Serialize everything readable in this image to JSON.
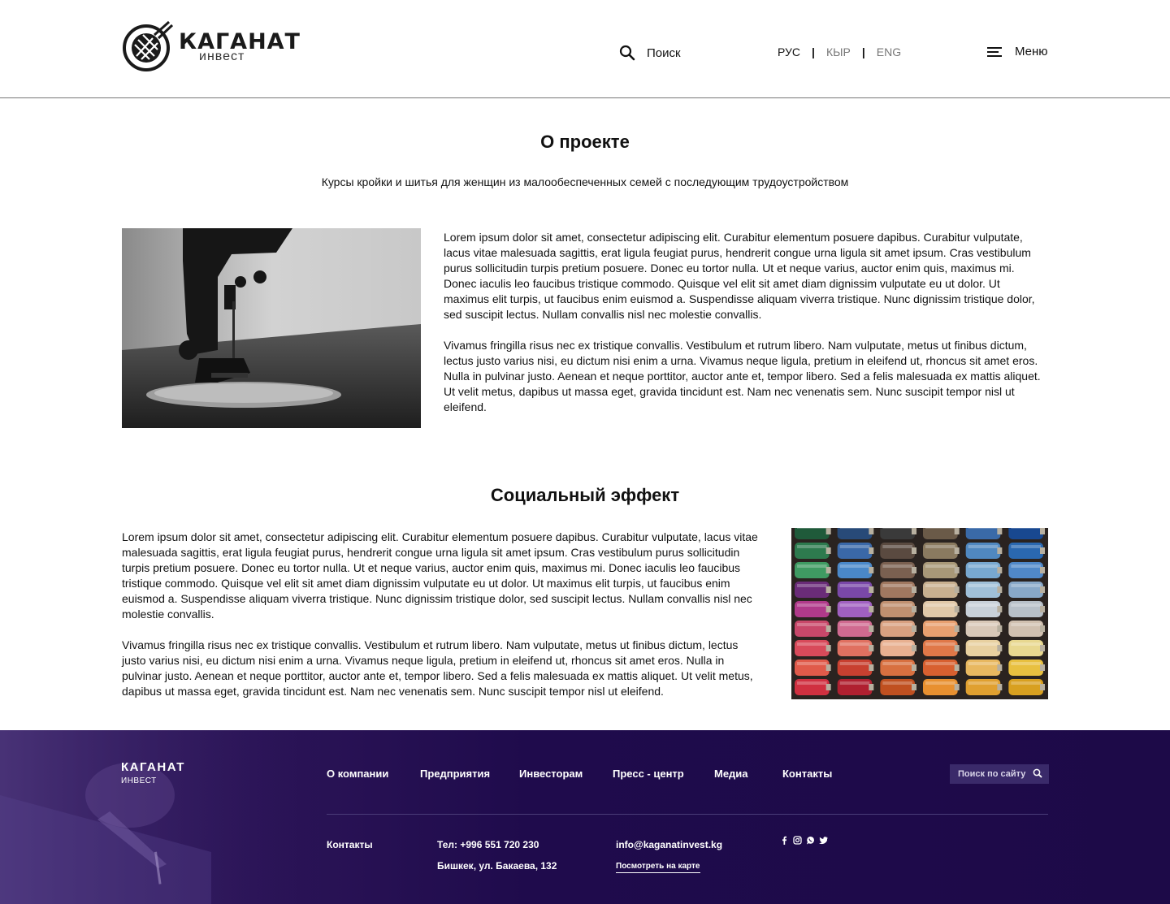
{
  "header": {
    "logo_title": "КАГАНАТ",
    "logo_sub": "инвест",
    "search_label": "Поиск",
    "languages": [
      {
        "label": "РУС",
        "active": true
      },
      {
        "label": "КЫР",
        "active": false
      },
      {
        "label": "ENG",
        "active": false
      }
    ],
    "lang_separator": "|",
    "menu_label": "Меню"
  },
  "about": {
    "title": "О проекте",
    "subtitle": "Курсы кройки и шитья для женщин из малообеспеченных семей с последующим трудоустройством",
    "paragraphs": [
      "Lorem ipsum dolor sit amet, consectetur adipiscing elit. Curabitur elementum posuere dapibus. Curabitur vulputate, lacus vitae malesuada sagittis, erat ligula feugiat purus, hendrerit congue urna ligula sit amet ipsum. Cras vestibulum purus sollicitudin turpis pretium posuere. Donec eu tortor nulla. Ut et neque varius, auctor enim quis, maximus mi. Donec iaculis leo faucibus tristique commodo. Quisque vel elit sit amet diam dignissim vulputate eu ut dolor. Ut maximus elit turpis, ut faucibus enim euismod a. Suspendisse aliquam viverra tristique. Nunc dignissim tristique dolor, sed suscipit lectus. Nullam convallis nisl nec molestie convallis.",
      "Vivamus fringilla risus nec ex tristique convallis. Vestibulum et rutrum libero. Nam vulputate, metus ut finibus dictum, lectus justo varius nisi, eu dictum nisi enim a urna. Vivamus neque ligula, pretium in eleifend ut, rhoncus sit amet eros. Nulla in pulvinar justo. Aenean et neque porttitor, auctor ante et, tempor libero. Sed a felis malesuada ex mattis aliquet. Ut velit metus, dapibus ut massa eget, gravida tincidunt est. Nam nec venenatis sem. Nunc suscipit tempor nisl ut eleifend."
    ]
  },
  "social": {
    "title": "Социальный эффект",
    "paragraphs": [
      "Lorem ipsum dolor sit amet, consectetur adipiscing elit. Curabitur elementum posuere dapibus. Curabitur vulputate, lacus vitae malesuada sagittis, erat ligula feugiat purus, hendrerit congue urna ligula sit amet ipsum. Cras vestibulum purus sollicitudin turpis pretium posuere. Donec eu tortor nulla. Ut et neque varius, auctor enim quis, maximus mi. Donec iaculis leo faucibus tristique commodo. Quisque vel elit sit amet diam dignissim vulputate eu ut dolor. Ut maximus elit turpis, ut faucibus enim euismod a. Suspendisse aliquam viverra tristique. Nunc dignissim tristique dolor, sed suscipit lectus. Nullam convallis nisl nec molestie convallis.",
      "Vivamus fringilla risus nec ex tristique convallis. Vestibulum et rutrum libero. Nam vulputate, metus ut finibus dictum, lectus justo varius nisi, eu dictum nisi enim a urna. Vivamus neque ligula, pretium in eleifend ut, rhoncus sit amet eros. Nulla in pulvinar justo. Aenean et neque porttitor, auctor ante et, tempor libero. Sed a felis malesuada ex mattis aliquet. Ut velit metus, dapibus ut massa eget, gravida tincidunt est. Nam nec venenatis sem. Nunc suscipit tempor nisl ut eleifend."
    ]
  },
  "footer": {
    "logo_title": "КАГАНАТ",
    "logo_sub": "ИНВЕСТ",
    "nav": [
      "О компании",
      "Предприятия",
      "Инвесторам",
      "Пресс - центр",
      "Медиа",
      "Контакты"
    ],
    "search_placeholder": "Поиск по сайту",
    "contacts_label": "Контакты",
    "phone": "Тел: +996 551 720 230",
    "address": "Бишкек, ул. Бакаева, 132",
    "email": "info@kaganatinvest.kg",
    "map_link": "Посмотреть на карте",
    "social_icons": [
      "facebook-icon",
      "instagram-icon",
      "whatsapp-icon",
      "twitter-icon"
    ]
  },
  "colors": {
    "footer_bg": "#1d0a48",
    "footer_search_bg": "#3a2a6a",
    "text": "#111111"
  }
}
